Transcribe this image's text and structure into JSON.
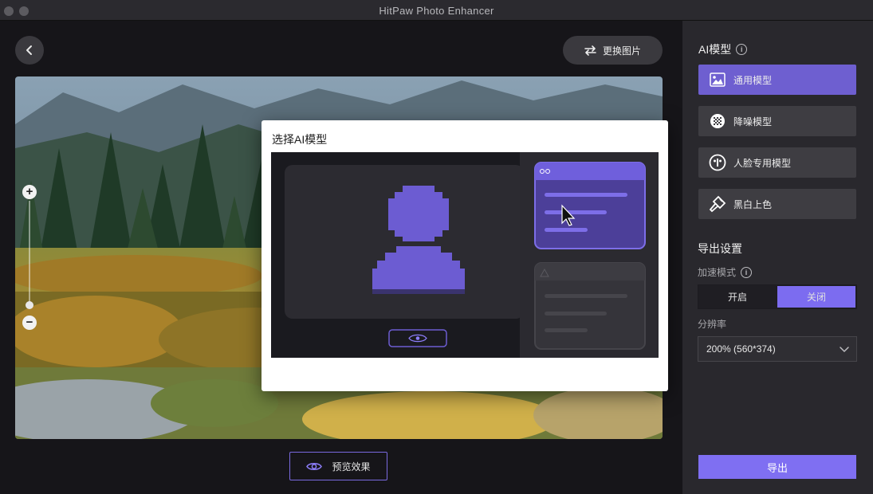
{
  "window": {
    "title": "HitPaw Photo Enhancer"
  },
  "toolbar": {
    "replace_label": "更换图片"
  },
  "preview": {
    "label": "预览效果"
  },
  "modal": {
    "title": "选择AI模型"
  },
  "sidebar": {
    "ai_model_heading": "AI模型",
    "models": [
      {
        "label": "通用模型",
        "icon": "image-icon",
        "active": true
      },
      {
        "label": "降噪模型",
        "icon": "denoise-icon",
        "active": false
      },
      {
        "label": "人脸专用模型",
        "icon": "face-icon",
        "active": false
      },
      {
        "label": "黑白上色",
        "icon": "brush-icon",
        "active": false
      }
    ],
    "export_settings_heading": "导出设置",
    "acceleration": {
      "label": "加速模式",
      "on_label": "开启",
      "off_label": "关闭",
      "selected": "关闭"
    },
    "resolution": {
      "label": "分辨率",
      "value": "200% (560*374)"
    },
    "export_label": "导出"
  },
  "colors": {
    "accent": "#7f6ff2",
    "active_model": "#6e5fd0",
    "sidebar_bg": "#29282d"
  }
}
